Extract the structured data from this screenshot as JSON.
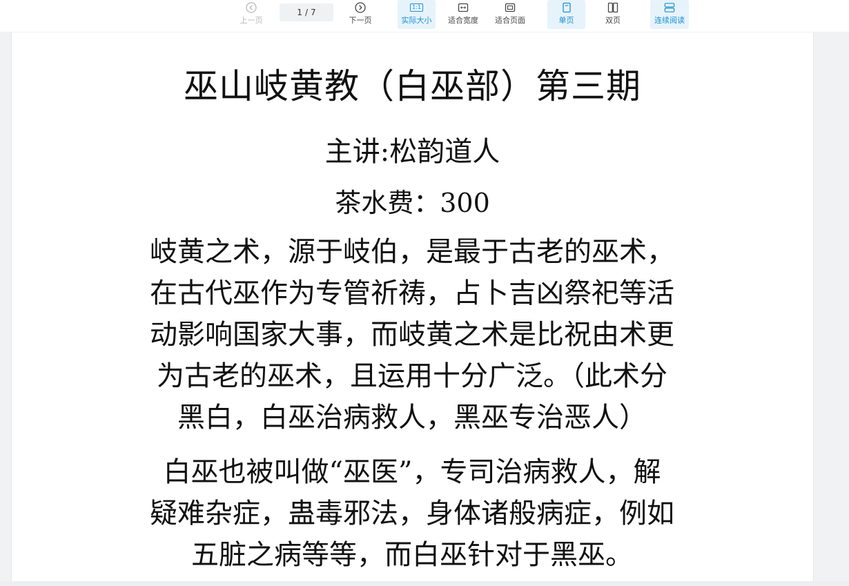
{
  "toolbar": {
    "prev_label": "上一页",
    "next_label": "下一页",
    "page_current": "1",
    "page_sep": "/",
    "page_total": "7",
    "actual_size_label": "实际大小",
    "fit_width_label": "适合宽度",
    "fit_page_label": "适合页面",
    "single_page_label": "单页",
    "double_page_label": "双页",
    "continuous_label": "连续阅读",
    "actual_size_icon_text": "1:1"
  },
  "document": {
    "title": "巫山岐黄教（白巫部）第三期",
    "speaker": "主讲:松韵道人",
    "fee": "茶水费：300",
    "paragraph1": [
      "岐黄之术，源于岐伯，是最于古老的巫术，",
      "在古代巫作为专管祈祷，占卜吉凶祭祀等活",
      "动影响国家大事，而岐黄之术是比祝由术更",
      "为古老的巫术，且运用十分广泛。（此术分",
      "黑白，白巫治病救人，黑巫专治恶人）"
    ],
    "paragraph2": [
      "白巫也被叫做“巫医”，专司治病救人，解",
      "疑难杂症，蛊毒邪法，身体诸般病症，例如",
      "五脏之病等等，而白巫针对于黑巫。"
    ]
  },
  "colors": {
    "accent": "#1a8fd6",
    "active_bg": "#e6f3fb",
    "disabled": "#b8b8b8"
  }
}
